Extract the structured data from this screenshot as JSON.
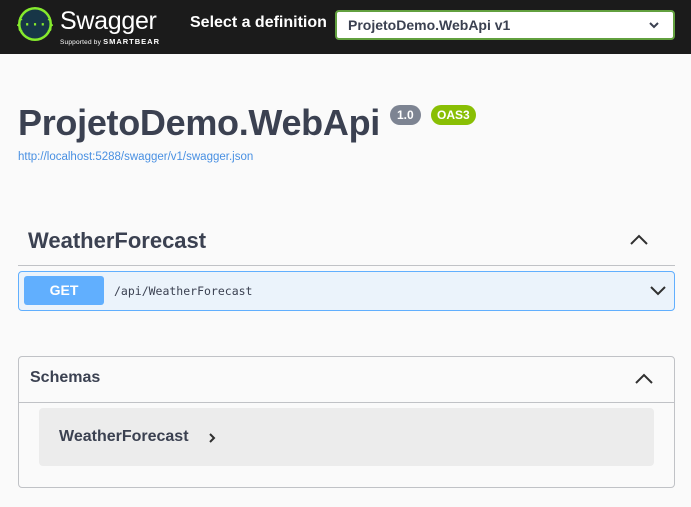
{
  "topbar": {
    "logo_text": "Swagger",
    "logo_sub_prefix": "Supported by",
    "logo_sub_brand": "SMARTBEAR",
    "select_label": "Select a definition",
    "selected_definition": "ProjetoDemo.WebApi v1",
    "icons": {
      "logo": "swagger-logo-icon",
      "caret": "chevron-down-icon"
    }
  },
  "info": {
    "title": "ProjetoDemo.WebApi",
    "version_badge": "1.0",
    "oas_badge": "OAS3",
    "spec_url": "http://localhost:5288/swagger/v1/swagger.json"
  },
  "tags": [
    {
      "name": "WeatherForecast",
      "operations": [
        {
          "method": "GET",
          "path": "/api/WeatherForecast"
        }
      ]
    }
  ],
  "schemas": {
    "title": "Schemas",
    "models": [
      {
        "name": "WeatherForecast"
      }
    ]
  },
  "colors": {
    "topbar": "#1b1b1b",
    "accent_green": "#62a03f",
    "get_blue": "#61affe",
    "get_bg": "#ebf3fb",
    "oas_green": "#89bf04",
    "version_gray": "#7d8492",
    "link": "#4990e2",
    "text": "#3b4151"
  }
}
